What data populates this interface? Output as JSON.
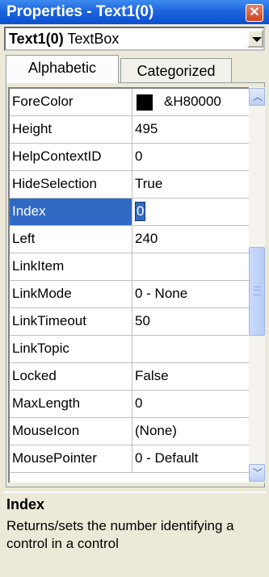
{
  "window": {
    "title": "Properties - Text1(0)",
    "close_glyph": "✕"
  },
  "object_selector": {
    "name": "Text1(0)",
    "type": " TextBox"
  },
  "tabs": [
    {
      "label": "Alphabetic",
      "active": true
    },
    {
      "label": "Categorized",
      "active": false
    }
  ],
  "properties": [
    {
      "name": "ForeColor",
      "value": "&H80000"
    },
    {
      "name": "Height",
      "value": "495"
    },
    {
      "name": "HelpContextID",
      "value": "0"
    },
    {
      "name": "HideSelection",
      "value": "True"
    },
    {
      "name": "Index",
      "value": "0",
      "selected": true
    },
    {
      "name": "Left",
      "value": "240"
    },
    {
      "name": "LinkItem",
      "value": ""
    },
    {
      "name": "LinkMode",
      "value": "0 - None"
    },
    {
      "name": "LinkTimeout",
      "value": "50"
    },
    {
      "name": "LinkTopic",
      "value": ""
    },
    {
      "name": "Locked",
      "value": "False"
    },
    {
      "name": "MaxLength",
      "value": "0"
    },
    {
      "name": "MouseIcon",
      "value": "(None)"
    },
    {
      "name": "MousePointer",
      "value": "0 - Default"
    }
  ],
  "description": {
    "title": "Index",
    "text": "Returns/sets the number identifying a control in a control"
  },
  "colors": {
    "title_bar": "#0a4fd0",
    "selection": "#316ac5",
    "fore_color_swatch": "#000000"
  }
}
